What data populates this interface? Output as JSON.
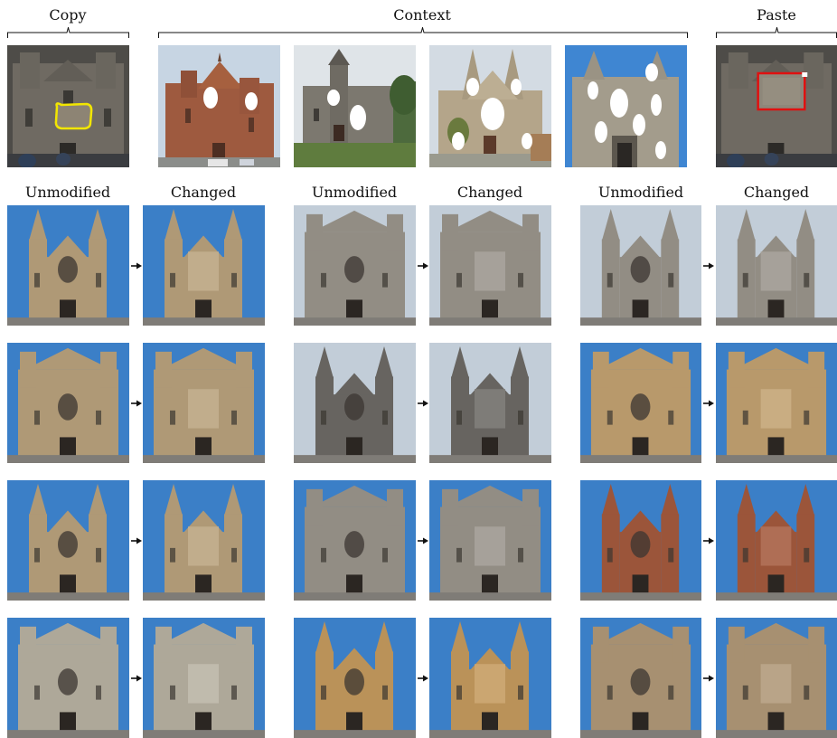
{
  "header": {
    "copy_label": "Copy",
    "context_label": "Context",
    "paste_label": "Paste"
  },
  "column_labels": {
    "unmodified": "Unmodified",
    "changed": "Changed"
  },
  "colors": {
    "sky_blue": "#3f86d2",
    "sky_pale": "#cdd9e4",
    "stone_gray": "#9a958c",
    "stone_tan": "#b9a27d",
    "brick_red": "#a45a3e",
    "mask_white": "#ffffff",
    "copy_outline": "#f2e600",
    "paste_box": "#e01010",
    "arrow": "#111111"
  }
}
